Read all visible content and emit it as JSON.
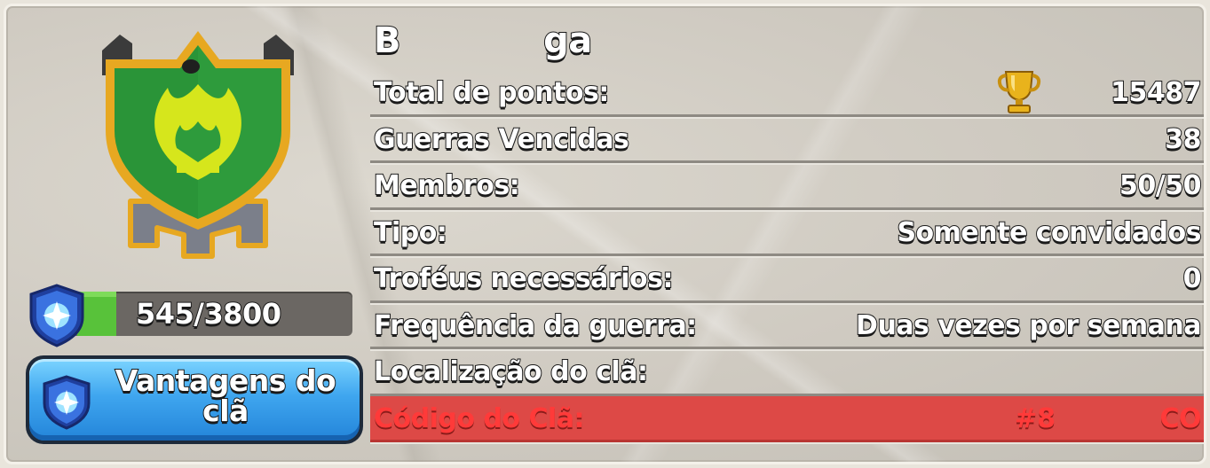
{
  "clan": {
    "name": "B            ga",
    "level_progress": "545/3800",
    "level_progress_fraction": 0.143,
    "perks_button": "Vantagens do clã"
  },
  "stats": [
    {
      "label": "Total de pontos:",
      "value": "15487",
      "icon": "trophy-icon"
    },
    {
      "label": "Guerras Vencidas",
      "value": "38"
    },
    {
      "label": "Membros:",
      "value": "50/50"
    },
    {
      "label": "Tipo:",
      "value": "Somente convidados"
    },
    {
      "label": "Troféus necessários:",
      "value": "0"
    },
    {
      "label": "Frequência da guerra:",
      "value": "Duas vezes por semana"
    },
    {
      "label": "Localização do clã:",
      "value": ""
    },
    {
      "label": "Código do Clã:",
      "code_prefix": "#8",
      "code_suffix": "CO"
    }
  ],
  "colors": {
    "badge_green": "#2e9b3c",
    "badge_flame": "#d6e61c",
    "badge_gold": "#e7a821",
    "highlight_red": "#dd4946",
    "button_blue": "#3fa6ef",
    "xp_green": "#58c23a"
  }
}
